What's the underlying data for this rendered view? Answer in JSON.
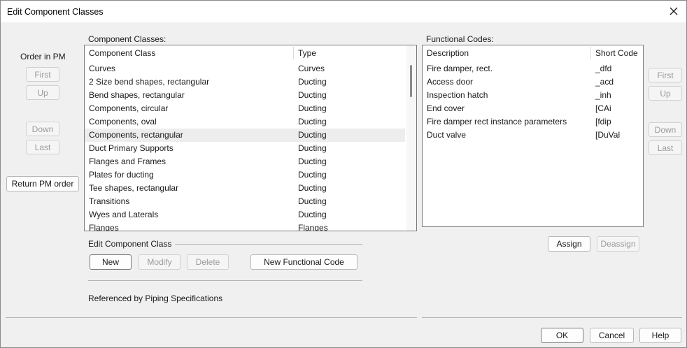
{
  "window": {
    "title": "Edit Component Classes"
  },
  "order_left": {
    "label": "Order in PM",
    "first": "First",
    "up": "Up",
    "down": "Down",
    "last": "Last",
    "return_pm_order": "Return PM order"
  },
  "component_classes": {
    "label": "Component Classes:",
    "columns": [
      "Component Class",
      "Type"
    ],
    "rows": [
      {
        "name": "Curves",
        "type": "Curves"
      },
      {
        "name": "2 Size bend shapes, rectangular",
        "type": "Ducting"
      },
      {
        "name": "Bend shapes, rectangular",
        "type": "Ducting"
      },
      {
        "name": "Components, circular",
        "type": "Ducting"
      },
      {
        "name": "Components, oval",
        "type": "Ducting"
      },
      {
        "name": "Components, rectangular",
        "type": "Ducting"
      },
      {
        "name": "Duct Primary Supports",
        "type": "Ducting"
      },
      {
        "name": "Flanges and Frames",
        "type": "Ducting"
      },
      {
        "name": "Plates for ducting",
        "type": "Ducting"
      },
      {
        "name": "Tee shapes, rectangular",
        "type": "Ducting"
      },
      {
        "name": "Transitions",
        "type": "Ducting"
      },
      {
        "name": "Wyes and Laterals",
        "type": "Ducting"
      },
      {
        "name": "Flanges",
        "type": "Flanges"
      }
    ]
  },
  "edit_component_class": {
    "label": "Edit Component Class",
    "new": "New",
    "modify": "Modify",
    "delete": "Delete",
    "new_functional_code": "New Functional Code"
  },
  "referenced_by": "Referenced by Piping Specifications",
  "functional_codes": {
    "label": "Functional Codes:",
    "columns": [
      "Description",
      "Short Code"
    ],
    "rows": [
      {
        "description": "Fire damper, rect.",
        "code": "_dfd"
      },
      {
        "description": "Access door",
        "code": "_acd"
      },
      {
        "description": "Inspection hatch",
        "code": "_inh"
      },
      {
        "description": "End cover",
        "code": "[CAi"
      },
      {
        "description": "Fire damper rect instance parameters",
        "code": "[fdip"
      },
      {
        "description": "Duct valve",
        "code": "[DuVal"
      }
    ],
    "assign": "Assign",
    "deassign": "Deassign"
  },
  "order_right": {
    "first": "First",
    "up": "Up",
    "down": "Down",
    "last": "Last"
  },
  "footer": {
    "ok": "OK",
    "cancel": "Cancel",
    "help": "Help"
  }
}
